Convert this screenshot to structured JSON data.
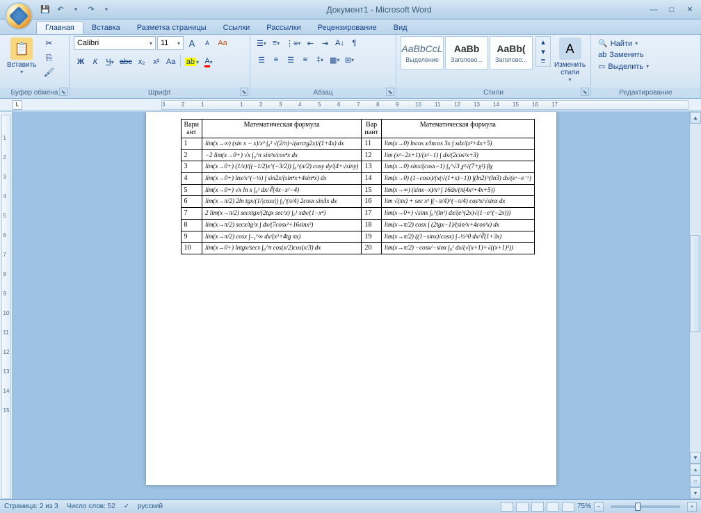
{
  "title": "Документ1 - Microsoft Word",
  "qat": {
    "save": "💾",
    "undo": "↶",
    "redo": "↷",
    "dd": "▾"
  },
  "tabs": [
    "Главная",
    "Вставка",
    "Разметка страницы",
    "Ссылки",
    "Рассылки",
    "Рецензирование",
    "Вид"
  ],
  "ribbon": {
    "clipboard": {
      "label": "Буфер обмена",
      "paste": "Вставить",
      "cut": "✂",
      "copy": "⎘",
      "fmt": "🖌"
    },
    "font": {
      "label": "Шрифт",
      "name": "Calibri",
      "size": "11",
      "grow": "A",
      "shrink": "A",
      "clear": "Aa",
      "b": "Ж",
      "i": "К",
      "u": "Ч",
      "strike": "abc",
      "sub": "x₂",
      "sup": "x²",
      "case": "Aa",
      "hl": "ab",
      "color": "A"
    },
    "para": {
      "label": "Абзац"
    },
    "styles": {
      "label": "Стили",
      "changestyles": "Изменить стили",
      "items": [
        {
          "prev": "AaBbCcL",
          "name": "Выделение"
        },
        {
          "prev": "AaBb",
          "name": "Заголово..."
        },
        {
          "prev": "AaBb(",
          "name": "Заголово..."
        }
      ]
    },
    "editing": {
      "label": "Редактирование",
      "find": "Найти",
      "replace": "Заменить",
      "select": "Выделить"
    }
  },
  "ruler_h": [
    "3",
    "2",
    "1",
    "",
    "1",
    "2",
    "3",
    "4",
    "5",
    "6",
    "7",
    "8",
    "9",
    "10",
    "11",
    "12",
    "13",
    "14",
    "15",
    "16",
    "17"
  ],
  "ruler_v": [
    "",
    "1",
    "2",
    "3",
    "4",
    "5",
    "6",
    "7",
    "8",
    "9",
    "10",
    "11",
    "12",
    "13",
    "14",
    "15"
  ],
  "table": {
    "headers": [
      "Вари ант",
      "Математическая формула",
      "Вар иант",
      "Математическая формула"
    ],
    "rows": [
      {
        "n1": "1",
        "f1": "lim(x→∞) (sin x − x)/x³    ∫₀² √(2/π)·√(arctg2x)/(1+4x) dx",
        "n2": "11",
        "f2": "lim(x→0) lncos x/lncos 3x    ∫ xdx/(x²+4x+5)"
      },
      {
        "n1": "2",
        "f1": "−2 lim(x→0+) √x    ∫₀^π sin³x/cos⁴x dx",
        "n2": "12",
        "f2": "lim (x²−2x+1)/(x²−1)    ∫ dx/(2cos²x+3)"
      },
      {
        "n1": "3",
        "f1": "lim(x→0+) (1/x)/((−1/2)x^(−3/2))    ∫₀^(π/2) cosy dy/(4+√siny)",
        "n2": "13",
        "f2": "lim(x→0) sinx/(cosx−1)    ∫₀^√3 χ²√(7+χ²) βχ"
      },
      {
        "n1": "4",
        "f1": "lim(x→0+) lnx/x^(−½)    ∫ sin2x/(sin⁴x+4sin⁴x) dx",
        "n2": "14",
        "f2": "lim(x→0) (1−cosx)/(x(√(1+x)−1))    ∫(ln2)^(ln3) dx/(eˣ−e⁻ˣ)"
      },
      {
        "n1": "5",
        "f1": "lim(x→0+) √x ln x    ∫₀¹ dx/∛(4x−x²−4)",
        "n2": "15",
        "f2": "lim(x→∞) (sinx−x)/x³    ∫ 16dx/(π(4x²+4x+5))"
      },
      {
        "n1": "6",
        "f1": "lim(x→π/2) 2ln tgx/(1/|cosx|)    ∫₀^(π/4) 2cosx sin3x dx",
        "n2": "16",
        "f2": "lim √(πx) + sec x³    ∫(−π/4)^(−π/4) cos³x/√sinx dx"
      },
      {
        "n1": "7",
        "f1": "2 lim(x→π/2) secxtgx/(2tgx sec²x)    ∫₀¹ xdx/(1−x⁴)",
        "n2": "17",
        "f2": "lim(x→0+) √sinx    ∫₀^(ln²) dx/(e^(2x)√(1−e^(−2x)))"
      },
      {
        "n1": "8",
        "f1": "lim(x→π/2) secx/tg²x    ∫ dx/(7cosx²+16sinx²)",
        "n2": "18",
        "f2": "lim(x→π/2) cosx    ∫ (2tgx−1)/(sin²x+4cos²x) dx"
      },
      {
        "n1": "9",
        "f1": "lim(x→π/2) cosx    ∫₋₁^∞ dx/(x²+4tg πx)",
        "n2": "19",
        "f2": "lim(x→π/2) ((1−sinx)/cosx)    ∫₋½^0 dx/∛(1+3x)"
      },
      {
        "n1": "10",
        "f1": "lim(x→0+) lntgx/secx    ∫₀^π cos(x/2)cos(x/3) dx",
        "n2": "20",
        "f2": "lim(x→π/2) −cosx/−sinx    ∫₀¹ dx/(√(x+1)+√((x+1)³))"
      }
    ]
  },
  "status": {
    "page": "Страница: 2 из 3",
    "words": "Число слов: 52",
    "lang": "русский",
    "zoom": "75%"
  }
}
